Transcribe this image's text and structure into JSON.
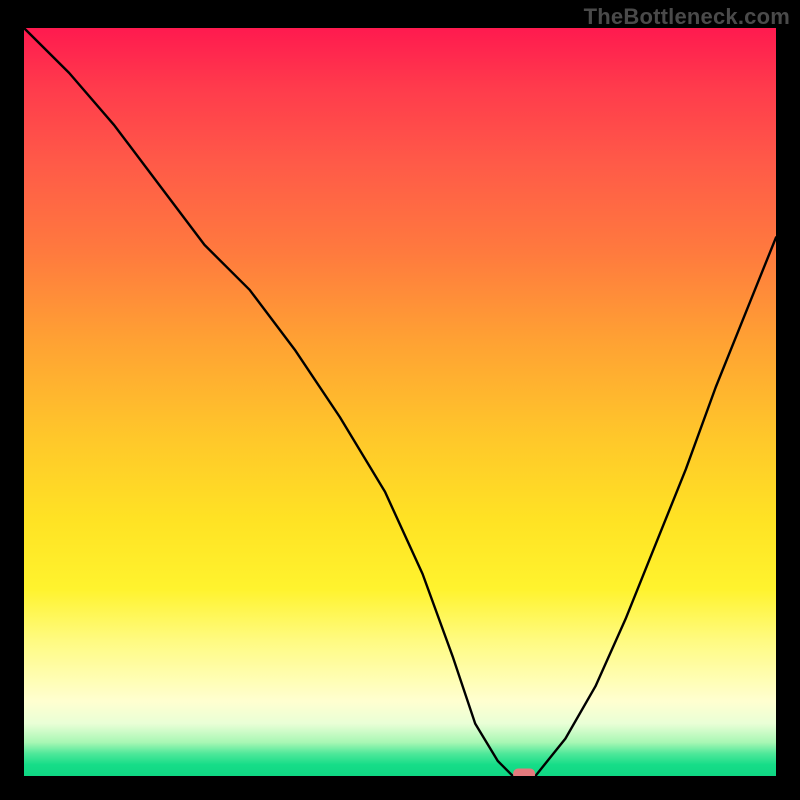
{
  "watermark": "TheBottleneck.com",
  "chart_data": {
    "type": "line",
    "title": "",
    "xlabel": "",
    "ylabel": "",
    "xlim": [
      0,
      100
    ],
    "ylim": [
      0,
      100
    ],
    "grid": false,
    "legend": false,
    "background": "rainbow-vertical-gradient",
    "series": [
      {
        "name": "bottleneck-curve",
        "x": [
          0,
          6,
          12,
          18,
          24,
          30,
          36,
          42,
          48,
          53,
          57,
          60,
          63,
          65,
          68,
          72,
          76,
          80,
          84,
          88,
          92,
          96,
          100
        ],
        "y": [
          100,
          94,
          87,
          79,
          71,
          65,
          57,
          48,
          38,
          27,
          16,
          7,
          2,
          0,
          0,
          5,
          12,
          21,
          31,
          41,
          52,
          62,
          72
        ]
      }
    ],
    "marker": {
      "x": 66.5,
      "y": 0,
      "shape": "rounded-rect",
      "color": "#e47a7d"
    },
    "gradient_stops": [
      {
        "pos": 0,
        "color": "#ff1a4f"
      },
      {
        "pos": 0.3,
        "color": "#ff7a3e"
      },
      {
        "pos": 0.55,
        "color": "#ffc82a"
      },
      {
        "pos": 0.75,
        "color": "#fff32e"
      },
      {
        "pos": 0.9,
        "color": "#ffffd0"
      },
      {
        "pos": 0.97,
        "color": "#4fe89a"
      },
      {
        "pos": 1.0,
        "color": "#0fd683"
      }
    ]
  }
}
